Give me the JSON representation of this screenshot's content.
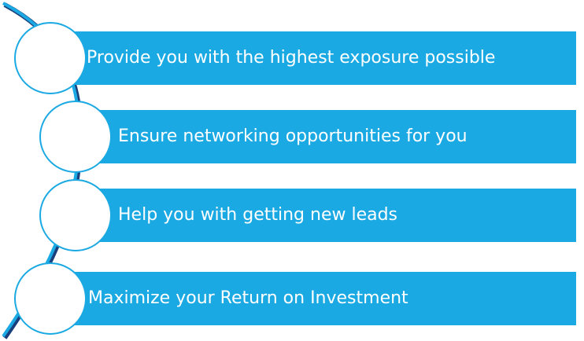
{
  "colors": {
    "bar": "#1ba9e3",
    "bar_text": "#ffffff",
    "circle_fill": "#ffffff",
    "circle_stroke": "#1ba9e3",
    "curve": "#1ba9e3",
    "curve_shadow": "#1a3f7a"
  },
  "items": [
    {
      "label": "Provide you with the highest exposure possible"
    },
    {
      "label": "Ensure networking opportunities for you"
    },
    {
      "label": "Help you with getting new leads"
    },
    {
      "label": "Maximize your Return on Investment"
    }
  ]
}
